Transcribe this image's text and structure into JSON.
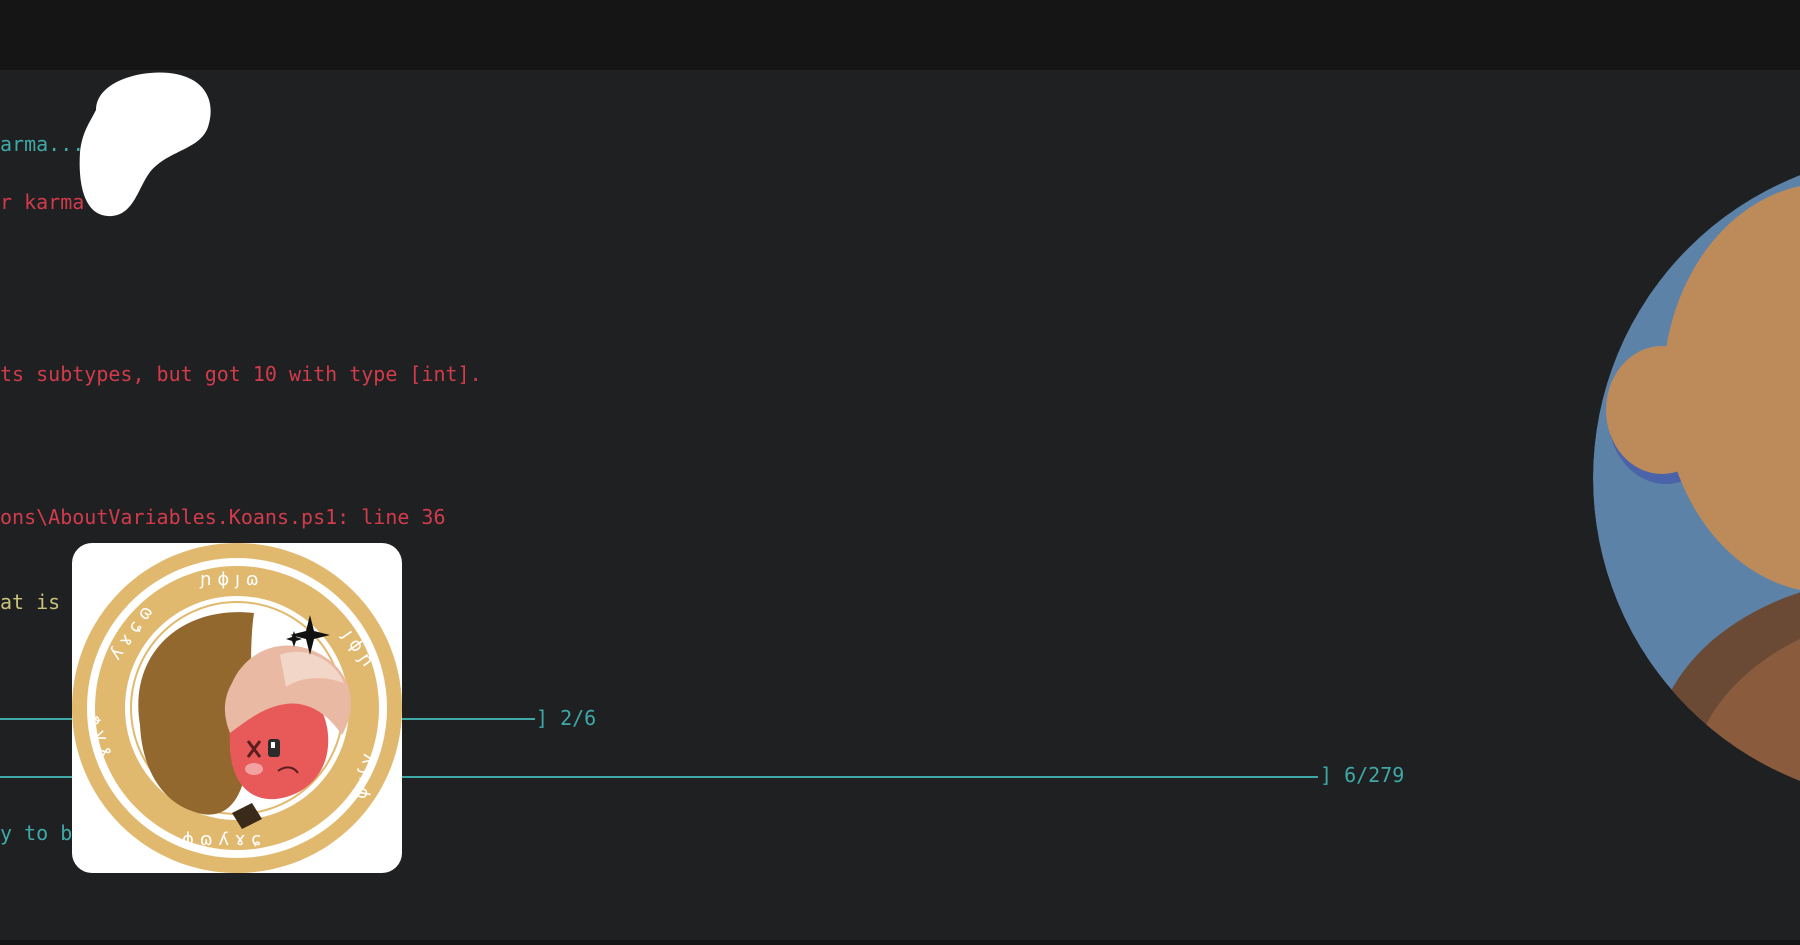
{
  "terminal": {
    "lines": {
      "karma_status": "arma...",
      "karma_warning": "r karma",
      "type_error": "ts subtypes, but got 10 with type [int].",
      "file_location": "ons\\AboutVariables.Koans.ps1: line 36",
      "question": "at is",
      "progress_koan_count": "] 2/6",
      "progress_total_count": "] 6/279",
      "encouragement": "y to b"
    }
  },
  "icons": {
    "blob": "patreon-blob-icon",
    "avatar_card": "anime-character-coin-avatar",
    "person_avatar": "person-avatar-icon"
  },
  "colors": {
    "cyan_text": "#3fa9a8",
    "red_text": "#d23b4c",
    "khaki_text": "#c9c27a",
    "terminal_bg": "#1f2021"
  }
}
